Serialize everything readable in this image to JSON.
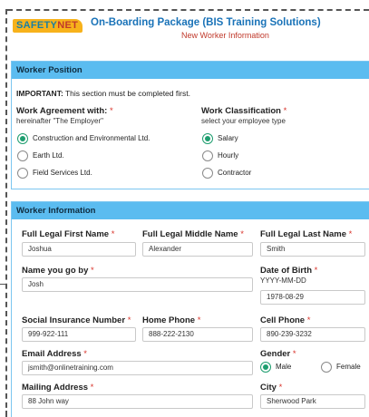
{
  "header": {
    "logo_part1": "SAFETY",
    "logo_part2": "NET",
    "title": "On-Boarding Package (BIS Training Solutions)",
    "subtitle": "New Worker Information"
  },
  "worker_position": {
    "heading": "Worker Position",
    "important_label": "IMPORTANT:",
    "important_text": " This section must be completed first.",
    "agreement_label": "Work Agreement with:",
    "agreement_hint": "hereinafter \"The Employer\"",
    "agreement_options": [
      {
        "label": "Construction and Environmental Ltd.",
        "selected": true
      },
      {
        "label": "Earth Ltd.",
        "selected": false
      },
      {
        "label": "Field Services Ltd.",
        "selected": false
      }
    ],
    "classification_label": "Work Classification",
    "classification_hint": "select your employee type",
    "classification_options": [
      {
        "label": "Salary",
        "selected": true
      },
      {
        "label": "Hourly",
        "selected": false
      },
      {
        "label": "Contractor",
        "selected": false
      }
    ]
  },
  "worker_information": {
    "heading": "Worker Information",
    "first_name_label": "Full Legal First Name",
    "first_name_value": "Joshua",
    "middle_name_label": "Full Legal Middle Name",
    "middle_name_value": "Alexander",
    "last_name_label": "Full Legal Last Name",
    "last_name_value": "Smith",
    "nickname_label": "Name you go by",
    "nickname_value": "Josh",
    "dob_label": "Date of Birth",
    "dob_hint": "YYYY-MM-DD",
    "dob_value": "1978-08-29",
    "sin_label": "Social Insurance Number",
    "sin_value": "999-922-111",
    "home_phone_label": "Home Phone",
    "home_phone_value": "888-222-2130",
    "cell_phone_label": "Cell Phone",
    "cell_phone_value": "890-239-3232",
    "email_label": "Email Address",
    "email_value": "jsmith@onlinetraining.com",
    "gender_label": "Gender",
    "gender_options": [
      {
        "label": "Male",
        "selected": true
      },
      {
        "label": "Female",
        "selected": false
      }
    ],
    "mailing_label": "Mailing Address",
    "mailing_value": "88 John way",
    "city_label": "City",
    "city_value": "Sherwood Park"
  },
  "required_marker": "*",
  "colors": {
    "header_bar": "#5bbcf0",
    "title_blue": "#1a73b8",
    "required_red": "#d9342b",
    "radio_selected": "#1e9e6f",
    "logo_orange": "#f7b21b"
  }
}
